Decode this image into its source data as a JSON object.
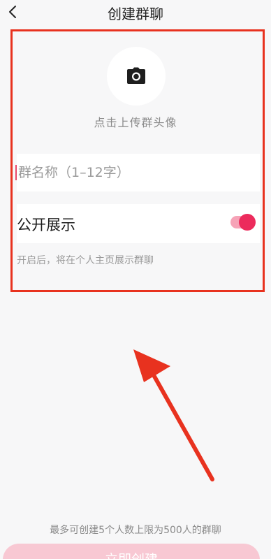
{
  "header": {
    "title": "创建群聊"
  },
  "avatar": {
    "upload_tip": "点击上传群头像"
  },
  "group_name": {
    "placeholder": "群名称（1–12字）",
    "value": ""
  },
  "public_display": {
    "label": "公开展示",
    "enabled": true,
    "hint": "开启后，将在个人主页展示群聊"
  },
  "footer": {
    "limit_note": "最多可创建5个人数上限为500人的群聊",
    "create_label": "立即创建"
  },
  "colors": {
    "accent": "#ec2b5c",
    "annotation": "#e8321f",
    "button_disabled": "#f8c8d3"
  },
  "icons": {
    "back": "chevron-left-icon",
    "avatar": "camera-icon"
  }
}
